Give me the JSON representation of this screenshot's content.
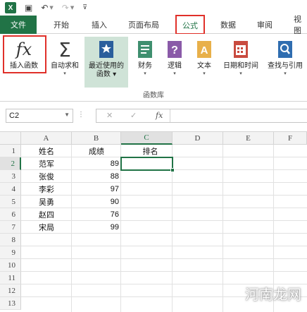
{
  "qat": {
    "app_icon": "X",
    "undo_icon": "undo-icon",
    "redo_icon": "redo-icon"
  },
  "tabs": {
    "file": "文件",
    "items": [
      "开始",
      "插入",
      "页面布局",
      "公式",
      "数据",
      "审阅",
      "视图"
    ],
    "active": "公式"
  },
  "ribbon": {
    "insert_function": {
      "icon": "fx",
      "label": "插入函数"
    },
    "autosum": {
      "icon": "Σ",
      "label": "自动求和"
    },
    "recent": {
      "label_line1": "最近使用的",
      "label_line2": "函数"
    },
    "financial": {
      "label": "财务"
    },
    "logical": {
      "label": "逻辑"
    },
    "text": {
      "label": "文本"
    },
    "datetime": {
      "label": "日期和时间"
    },
    "lookup": {
      "label": "查找与引用"
    },
    "group_label": "函数库"
  },
  "formula_bar": {
    "name_box": "C2",
    "fx_label": "fx",
    "cancel": "✕",
    "enter": "✓",
    "value": ""
  },
  "grid": {
    "columns": [
      "A",
      "B",
      "C",
      "D",
      "E",
      "F"
    ],
    "selected_column": "C",
    "rows": [
      "1",
      "2",
      "3",
      "4",
      "5",
      "6",
      "7",
      "8",
      "9",
      "10",
      "11",
      "12",
      "13"
    ],
    "selected_row": "2",
    "header_row": {
      "A": "姓名",
      "B": "成绩",
      "C": "排名"
    },
    "data": [
      {
        "name": "范军",
        "score": "89"
      },
      {
        "name": "张俊",
        "score": "88"
      },
      {
        "name": "李彩",
        "score": "97"
      },
      {
        "name": "吴勇",
        "score": "90"
      },
      {
        "name": "赵四",
        "score": "76"
      },
      {
        "name": "宋局",
        "score": "99"
      }
    ],
    "active_cell": "C2"
  },
  "watermark": "河南龙网",
  "colors": {
    "excel_green": "#217346",
    "highlight_red": "#e0302a",
    "ribbon_select": "#cfe3d7"
  }
}
